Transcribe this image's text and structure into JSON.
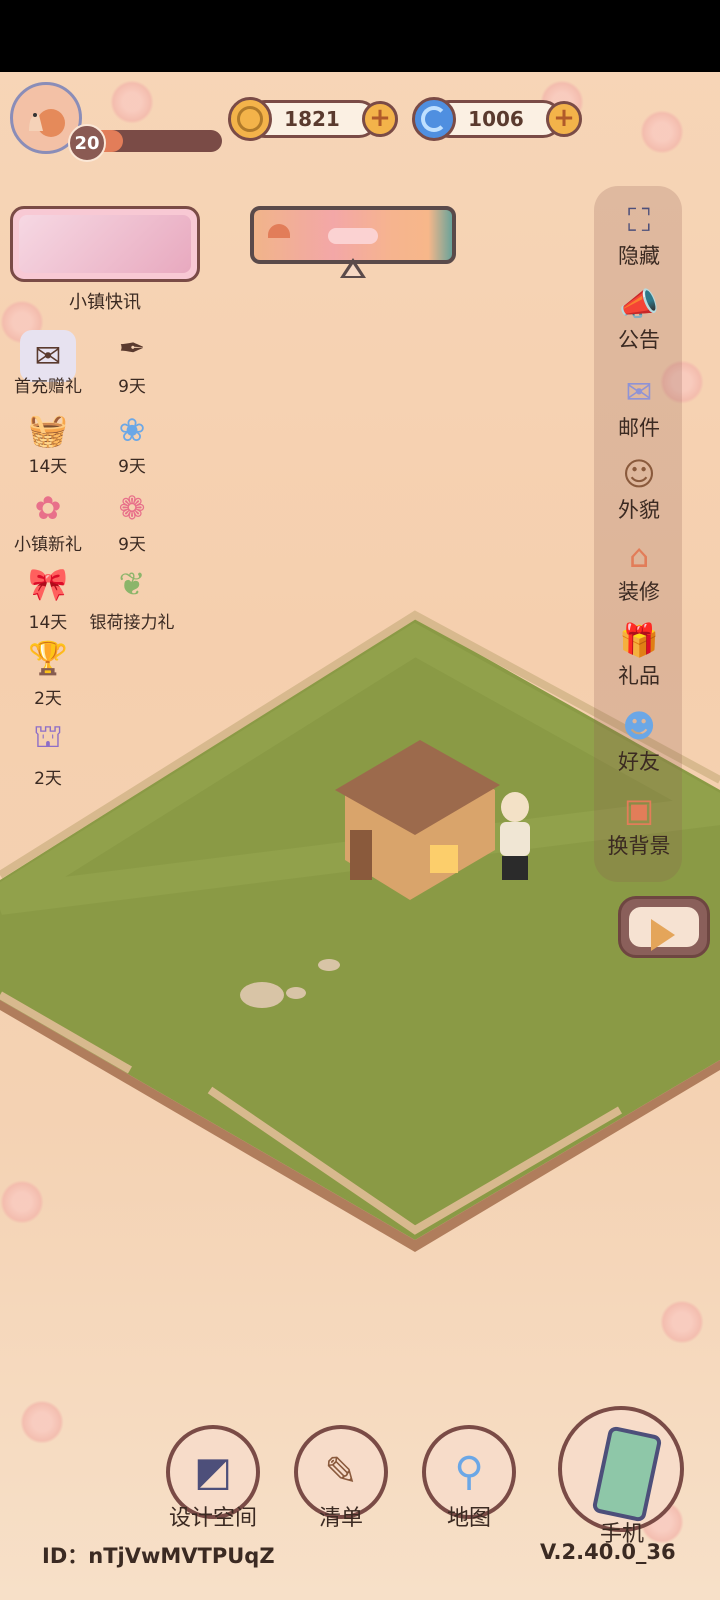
{
  "profile": {
    "level": "20",
    "level_progress": 0.3,
    "avatar_icon": "snail-icon"
  },
  "currencies": [
    {
      "value": "1821",
      "icon": "coin-icon",
      "color": "#f3b34a"
    },
    {
      "value": "1006",
      "icon": "swirl-gem-icon",
      "color": "#4f8fe0"
    }
  ],
  "news": {
    "label": "小镇快讯"
  },
  "events": [
    {
      "label": "首充赠礼",
      "icon": "envelope-gift-icon"
    },
    {
      "label": "9天",
      "icon": "letter-quill-icon"
    },
    {
      "label": "14天",
      "icon": "basket-icon"
    },
    {
      "label": "9天",
      "icon": "blue-flower-box-icon"
    },
    {
      "label": "小镇新礼",
      "icon": "rose-badge-icon"
    },
    {
      "label": "9天",
      "icon": "pink-bow-icon"
    },
    {
      "label": "14天",
      "icon": "ribbon-icon"
    },
    {
      "label": "银荷接力礼",
      "icon": "lotus-icon"
    },
    {
      "label": "2天",
      "icon": "trophy-icon"
    },
    {
      "label": "2天",
      "icon": "glass-dome-icon"
    }
  ],
  "right_menu": [
    {
      "label": "隐藏",
      "icon": "frame-icon"
    },
    {
      "label": "公告",
      "icon": "megaphone-icon"
    },
    {
      "label": "邮件",
      "icon": "mail-icon"
    },
    {
      "label": "外貌",
      "icon": "face-icon"
    },
    {
      "label": "装修",
      "icon": "house-wrench-icon"
    },
    {
      "label": "礼品",
      "icon": "gift-icon"
    },
    {
      "label": "好友",
      "icon": "friend-book-icon"
    },
    {
      "label": "换背景",
      "icon": "background-icon"
    }
  ],
  "bottom_nav": [
    {
      "label": "设计空间",
      "icon": "design-icon"
    },
    {
      "label": "清单",
      "icon": "list-icon"
    },
    {
      "label": "地图",
      "icon": "map-pin-icon"
    },
    {
      "label": "手机",
      "icon": "phone-icon"
    }
  ],
  "footer": {
    "id_text": "ID：nTjVwMVTPUqZ",
    "version": "V.2.40.0_36"
  }
}
